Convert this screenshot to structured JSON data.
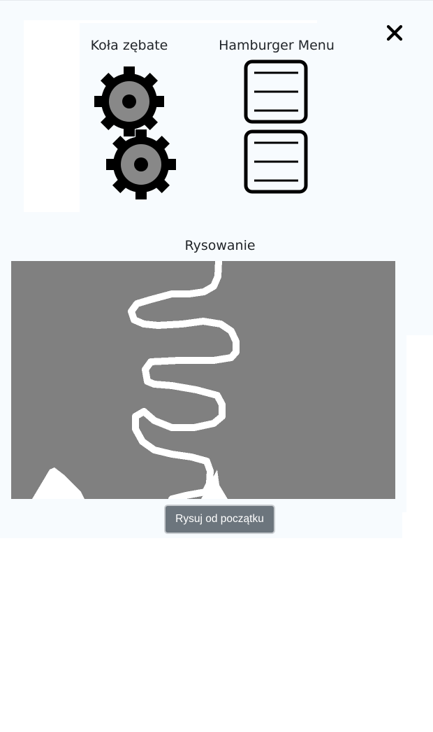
{
  "header": {
    "close_icon": "close-icon"
  },
  "sections": {
    "gears": {
      "title": "Koła zębate",
      "icon": "gear-icon",
      "count": 2
    },
    "hamburger": {
      "title": "Hamburger Menu",
      "icon": "hamburger-menu-icon",
      "count": 2
    },
    "drawing": {
      "title": "Rysowanie",
      "canvas_color": "#808080",
      "stroke_color": "#ffffff",
      "reset_label": "Rysuj od początku"
    }
  },
  "colors": {
    "background": "#f7fbfe",
    "button": "#6c757d",
    "gear_outer": "#000000",
    "gear_inner": "#888888"
  }
}
